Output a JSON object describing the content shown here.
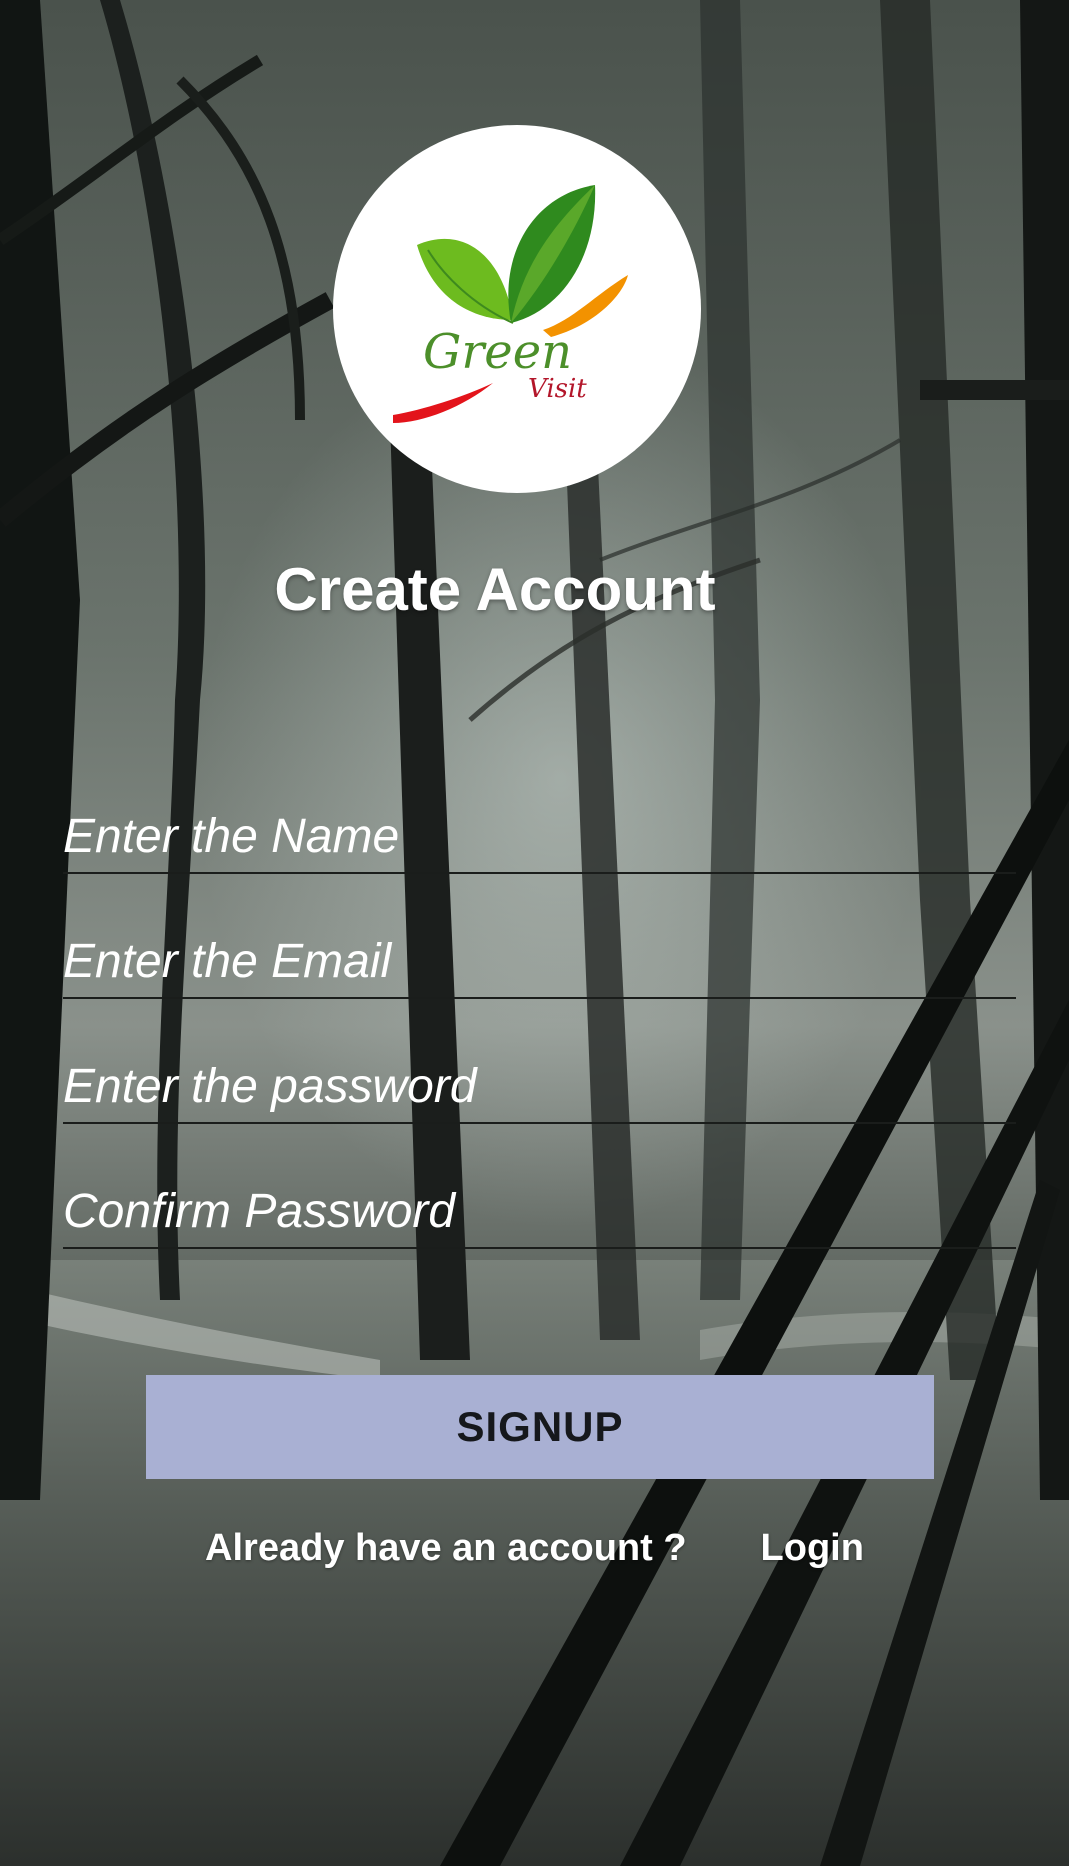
{
  "logo": {
    "brand_word": "Green",
    "brand_sub": "Visit",
    "colors": {
      "leaf_light": "#6dbb1f",
      "leaf_dark": "#2f8a1e",
      "swoosh_orange": "#f39200",
      "swoosh_red": "#e3141b",
      "text_green": "#4c8f2a",
      "text_red": "#b3162a"
    }
  },
  "title": "Create Account",
  "form": {
    "name_placeholder": "Enter the Name",
    "name_value": "",
    "email_placeholder": "Enter the Email",
    "email_value": "",
    "password_placeholder": "Enter the password",
    "password_value": "",
    "confirm_placeholder": "Confirm Password",
    "confirm_value": ""
  },
  "signup_label": "SIGNUP",
  "account_prompt": "Already have an account ?",
  "login_label": "Login",
  "colors": {
    "button_bg": "#a9b0d3",
    "text": "#ffffff"
  }
}
